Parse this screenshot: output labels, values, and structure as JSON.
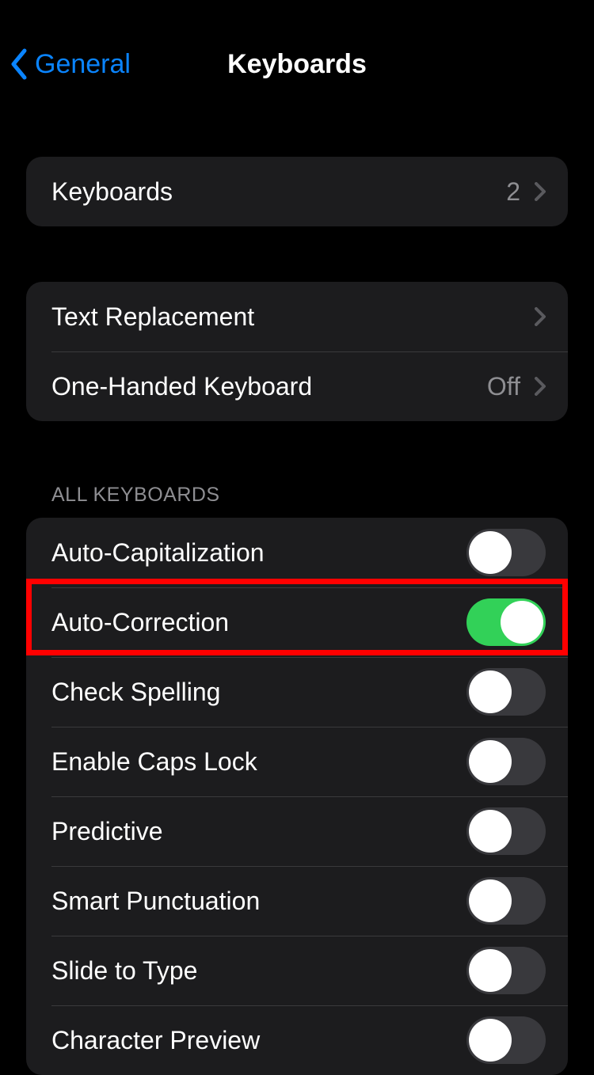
{
  "nav": {
    "back_label": "General",
    "title": "Keyboards"
  },
  "group1": {
    "keyboards_label": "Keyboards",
    "keyboards_count": "2"
  },
  "group2": {
    "text_replacement_label": "Text Replacement",
    "one_handed_label": "One-Handed Keyboard",
    "one_handed_value": "Off"
  },
  "section_header": "ALL KEYBOARDS",
  "toggles": {
    "auto_cap": "Auto-Capitalization",
    "auto_correct": "Auto-Correction",
    "check_spell": "Check Spelling",
    "caps_lock": "Enable Caps Lock",
    "predictive": "Predictive",
    "smart_punct": "Smart Punctuation",
    "slide_type": "Slide to Type",
    "char_preview": "Character Preview"
  }
}
